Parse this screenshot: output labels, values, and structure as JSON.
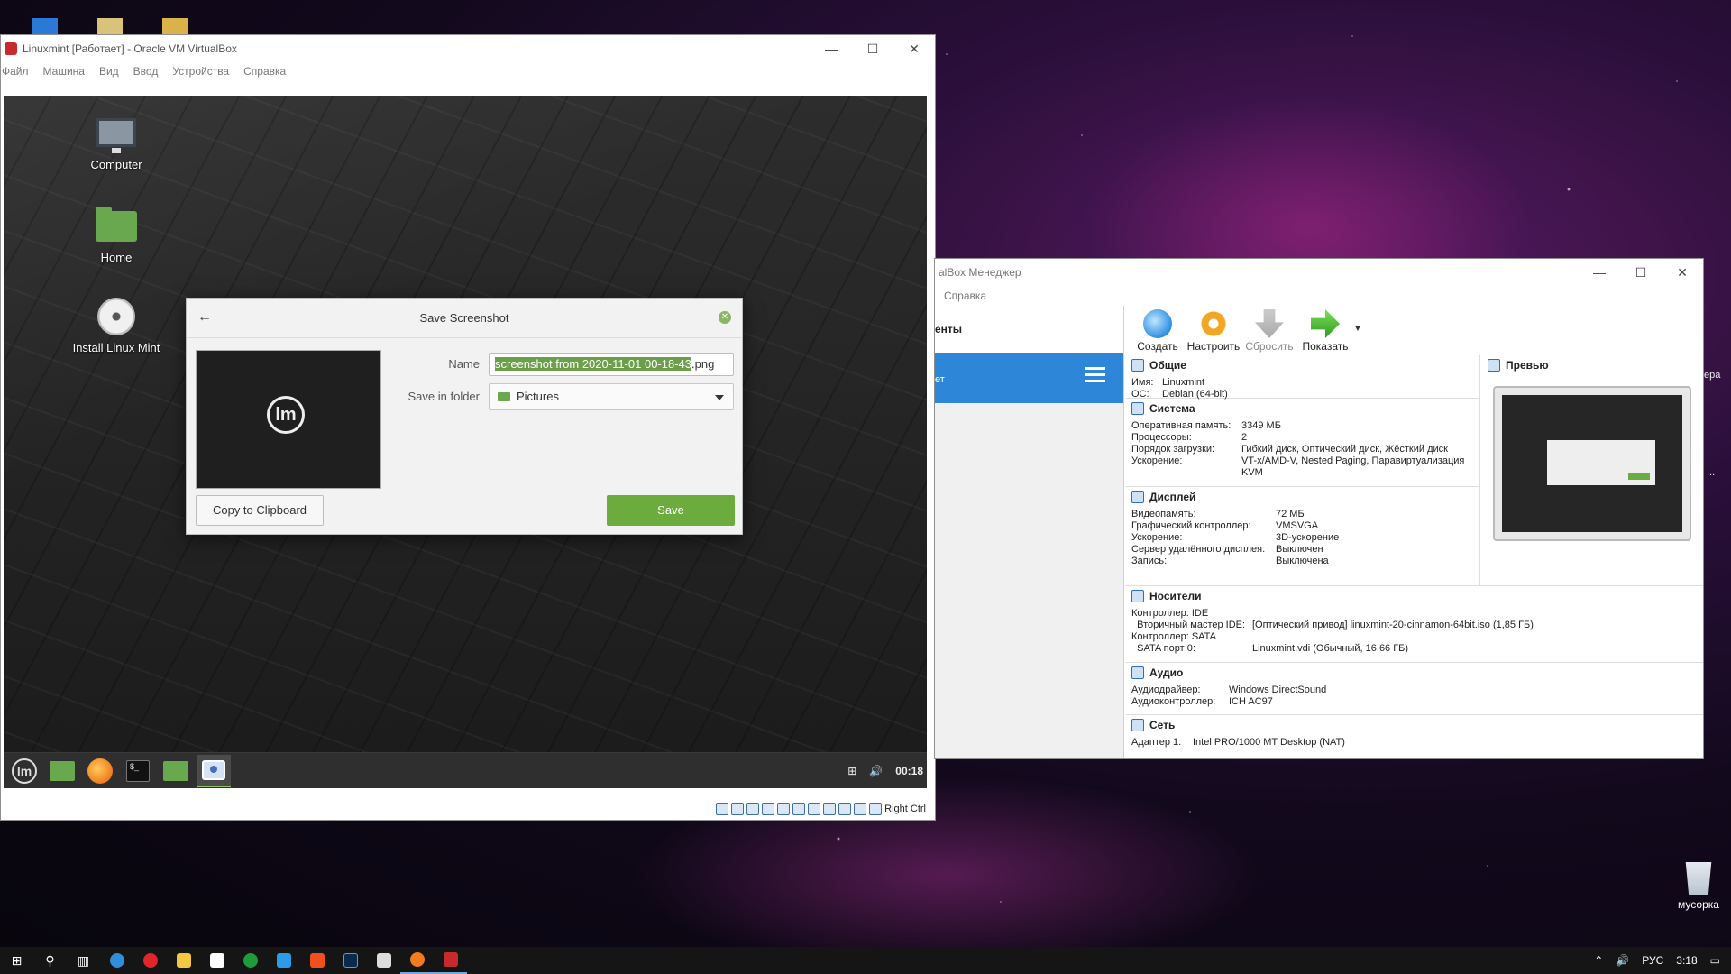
{
  "host": {
    "recycle_bin_label": "мусорка",
    "edge_labels": [
      "ера",
      "..."
    ],
    "taskbar": {
      "language": "РУС",
      "time": "3:18"
    }
  },
  "vm_window": {
    "title": "Linuxmint [Работает] - Oracle VM VirtualBox",
    "menu": [
      "Файл",
      "Машина",
      "Вид",
      "Ввод",
      "Устройства",
      "Справка"
    ],
    "host_key_label": "Right Ctrl"
  },
  "guest": {
    "desktop_icons": [
      {
        "label": "Computer",
        "icon": "computer-icon"
      },
      {
        "label": "Home",
        "icon": "home-folder-icon"
      },
      {
        "label": "Install Linux Mint",
        "icon": "disc-icon"
      }
    ],
    "panel_clock": "00:18",
    "terminal_prompt": "$_"
  },
  "dialog": {
    "title": "Save Screenshot",
    "name_label": "Name",
    "name_value_selected": "screenshot from 2020-11-01 00-18-43",
    "name_value_ext": ".png",
    "folder_label": "Save in folder",
    "folder_value": "Pictures",
    "copy_button": "Copy to Clipboard",
    "save_button": "Save",
    "thumb_logo": "lm"
  },
  "manager": {
    "title": "alBox Менеджер",
    "menu_item": "Справка",
    "tools_label": "енты",
    "vm_item_text": "ет",
    "toolbar": [
      {
        "label": "Создать",
        "icon": "new-icon",
        "enabled": true
      },
      {
        "label": "Настроить",
        "icon": "settings-icon",
        "enabled": true
      },
      {
        "label": "Сбросить",
        "icon": "discard-icon",
        "enabled": false
      },
      {
        "label": "Показать",
        "icon": "show-icon",
        "enabled": true
      }
    ],
    "general": {
      "title": "Общие",
      "rows": [
        [
          "Имя:",
          "Linuxmint"
        ],
        [
          "ОС:",
          "Debian (64-bit)"
        ]
      ]
    },
    "system": {
      "title": "Система",
      "rows": [
        [
          "Оперативная память:",
          "3349 МБ"
        ],
        [
          "Процессоры:",
          "2"
        ],
        [
          "Порядок загрузки:",
          "Гибкий диск, Оптический диск, Жёсткий диск"
        ],
        [
          "Ускорение:",
          "VT-x/AMD-V, Nested Paging, Паравиртуализация KVM"
        ]
      ]
    },
    "display": {
      "title": "Дисплей",
      "rows": [
        [
          "Видеопамять:",
          "72 МБ"
        ],
        [
          "Графический контроллер:",
          "VMSVGA"
        ],
        [
          "Ускорение:",
          "3D-ускорение"
        ],
        [
          "Сервер удалённого дисплея:",
          "Выключен"
        ],
        [
          "Запись:",
          "Выключена"
        ]
      ]
    },
    "storage": {
      "title": "Носители",
      "rows": [
        [
          "Контроллер: IDE",
          ""
        ],
        [
          "  Вторичный мастер IDE:",
          "[Оптический привод] linuxmint-20-cinnamon-64bit.iso (1,85 ГБ)"
        ],
        [
          "Контроллер: SATA",
          ""
        ],
        [
          "  SATA порт 0:",
          "Linuxmint.vdi (Обычный, 16,66 ГБ)"
        ]
      ]
    },
    "audio": {
      "title": "Аудио",
      "rows": [
        [
          "Аудиодрайвер:",
          "Windows DirectSound"
        ],
        [
          "Аудиоконтроллер:",
          "ICH AC97"
        ]
      ]
    },
    "network": {
      "title": "Сеть",
      "rows": [
        [
          "Адаптер 1:",
          "Intel PRO/1000 MT Desktop (NAT)"
        ]
      ]
    },
    "preview_title": "Превью"
  }
}
